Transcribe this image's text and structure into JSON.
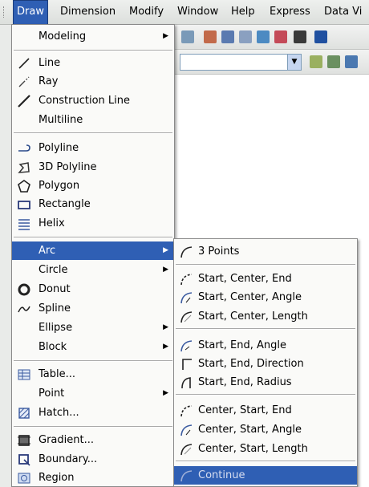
{
  "menubar": {
    "items": [
      "Draw",
      "Dimension",
      "Modify",
      "Window",
      "Help",
      "Express",
      "Data Vi"
    ]
  },
  "draw_menu": {
    "items": [
      {
        "label": "Modeling",
        "submenu": true,
        "icon": "none"
      },
      {
        "label": "Line",
        "icon": "line-icon"
      },
      {
        "label": "Ray",
        "icon": "ray-icon"
      },
      {
        "label": "Construction Line",
        "icon": "construction-line-icon"
      },
      {
        "label": "Multiline",
        "icon": "none"
      },
      {
        "label": "Polyline",
        "icon": "polyline-icon"
      },
      {
        "label": "3D Polyline",
        "icon": "3d-polyline-icon"
      },
      {
        "label": "Polygon",
        "icon": "polygon-icon"
      },
      {
        "label": "Rectangle",
        "icon": "rectangle-icon"
      },
      {
        "label": "Helix",
        "icon": "helix-icon"
      },
      {
        "label": "Arc",
        "submenu": true,
        "highlighted": true,
        "icon": "none"
      },
      {
        "label": "Circle",
        "submenu": true,
        "icon": "none"
      },
      {
        "label": "Donut",
        "icon": "donut-icon"
      },
      {
        "label": "Spline",
        "icon": "spline-icon"
      },
      {
        "label": "Ellipse",
        "submenu": true,
        "icon": "none"
      },
      {
        "label": "Block",
        "submenu": true,
        "icon": "none"
      },
      {
        "label": "Table...",
        "icon": "table-icon"
      },
      {
        "label": "Point",
        "submenu": true,
        "icon": "none"
      },
      {
        "label": "Hatch...",
        "icon": "hatch-icon"
      },
      {
        "label": "Gradient...",
        "icon": "gradient-icon"
      },
      {
        "label": "Boundary...",
        "icon": "boundary-icon"
      },
      {
        "label": "Region",
        "icon": "region-icon"
      }
    ]
  },
  "arc_menu": {
    "items": [
      {
        "label": "3 Points",
        "icon": "arc-3points-icon"
      },
      {
        "label": "Start, Center, End",
        "icon": "arc-sce-icon"
      },
      {
        "label": "Start, Center, Angle",
        "icon": "arc-sca-icon"
      },
      {
        "label": "Start, Center, Length",
        "icon": "arc-scl-icon"
      },
      {
        "label": "Start, End, Angle",
        "icon": "arc-sea-icon"
      },
      {
        "label": "Start, End, Direction",
        "icon": "arc-sed-icon"
      },
      {
        "label": "Start, End, Radius",
        "icon": "arc-ser-icon"
      },
      {
        "label": "Center, Start, End",
        "icon": "arc-cse-icon"
      },
      {
        "label": "Center, Start, Angle",
        "icon": "arc-csa-icon"
      },
      {
        "label": "Center, Start, Length",
        "icon": "arc-csl-icon"
      },
      {
        "label": "Continue",
        "highlighted": true,
        "icon": "arc-continue-icon"
      }
    ]
  },
  "colors": {
    "highlight": "#2f5fb4",
    "menu_bg": "#fafaf8",
    "menubar_bg": "#dcdfdc"
  }
}
